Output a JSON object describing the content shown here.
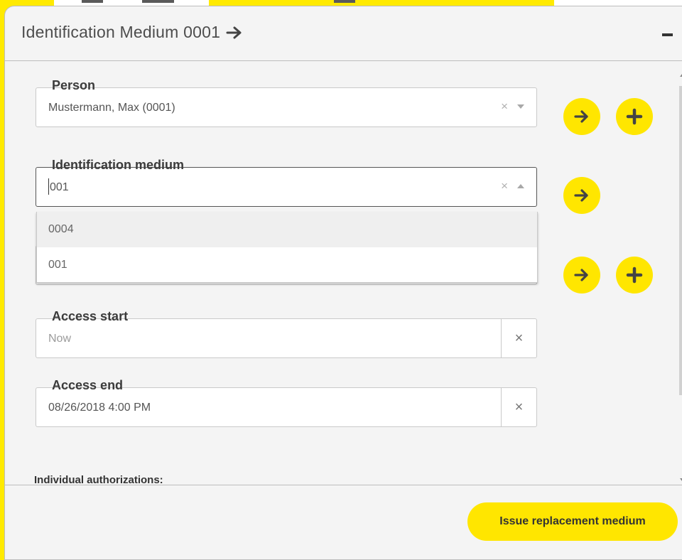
{
  "dialog": {
    "title": "Identification Medium 0001",
    "minimize_icon": "minus-icon"
  },
  "form": {
    "person": {
      "label": "Person",
      "value": "Mustermann, Max (0001)",
      "clear": "×"
    },
    "identification_medium": {
      "label": "Identification medium",
      "input_value": "001",
      "clear": "×",
      "options": [
        "0004",
        "001"
      ]
    },
    "access_start": {
      "label": "Access start",
      "placeholder": "Now",
      "clear": "×"
    },
    "access_end": {
      "label": "Access end",
      "value": "08/26/2018 4:00 PM",
      "clear": "×"
    },
    "individual_authorizations_label": "Individual authorizations:"
  },
  "footer": {
    "primary_button": "Issue replacement medium"
  },
  "colors": {
    "accent": "#ffe600",
    "panel": "#f4f4f4",
    "text": "#4d4d4d"
  }
}
